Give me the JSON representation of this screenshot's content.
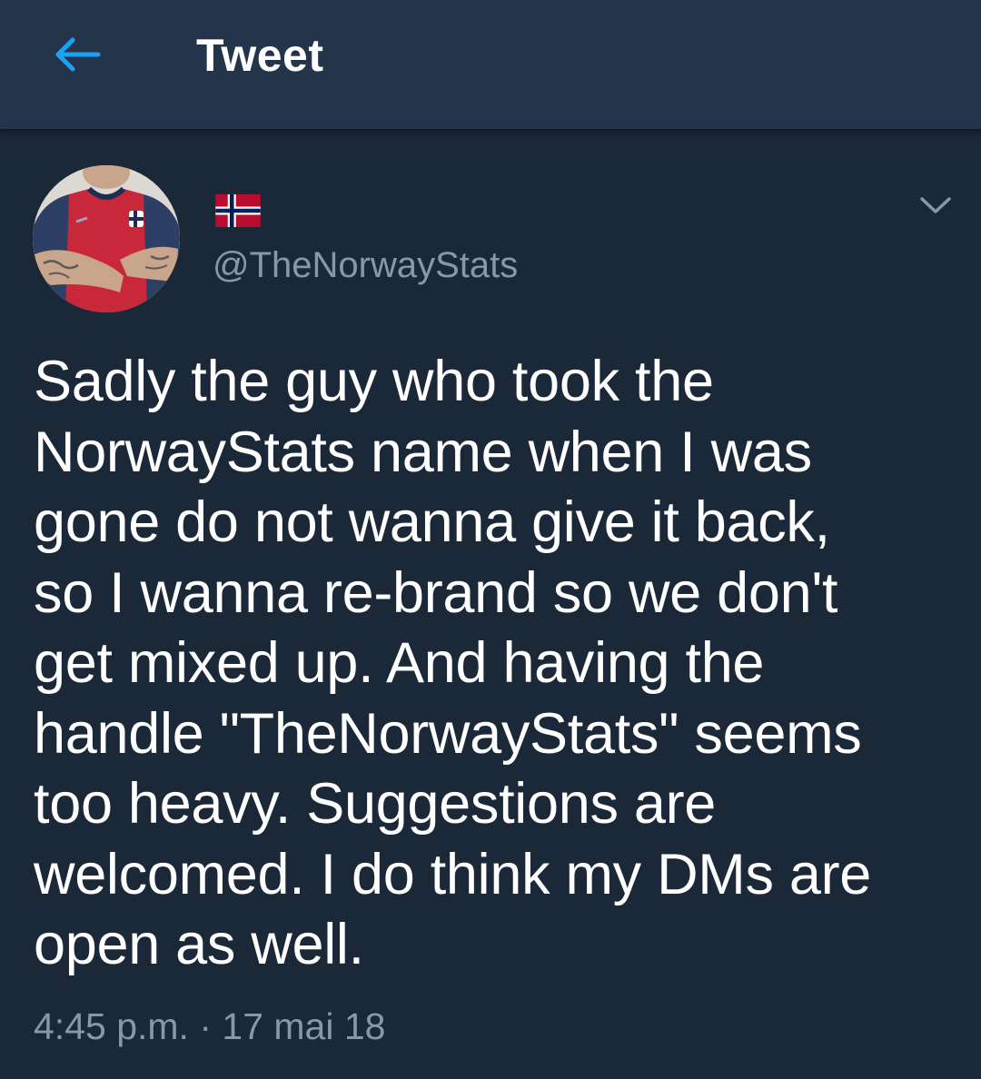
{
  "header": {
    "title": "Tweet",
    "back_icon": "arrow-left-icon"
  },
  "tweet": {
    "display_name_emoji": "norway-flag",
    "handle": "@TheNorwayStats",
    "text": "Sadly the guy who took the\nNorwayStats name when I was\ngone do not wanna give it back,\nso I wanna re-brand so we don't\nget mixed up. And having the\nhandle \"TheNorwayStats\" seems\ntoo heavy. Suggestions are\nwelcomed. I do think my DMs are\nopen as well.",
    "time": "4:45 p.m.",
    "separator": "·",
    "date": "17 mai 18"
  },
  "colors": {
    "background": "#1b2838",
    "header_background": "#24344a",
    "accent": "#1da1f2",
    "secondary_text": "#8899a6",
    "primary_text": "#ffffff"
  }
}
